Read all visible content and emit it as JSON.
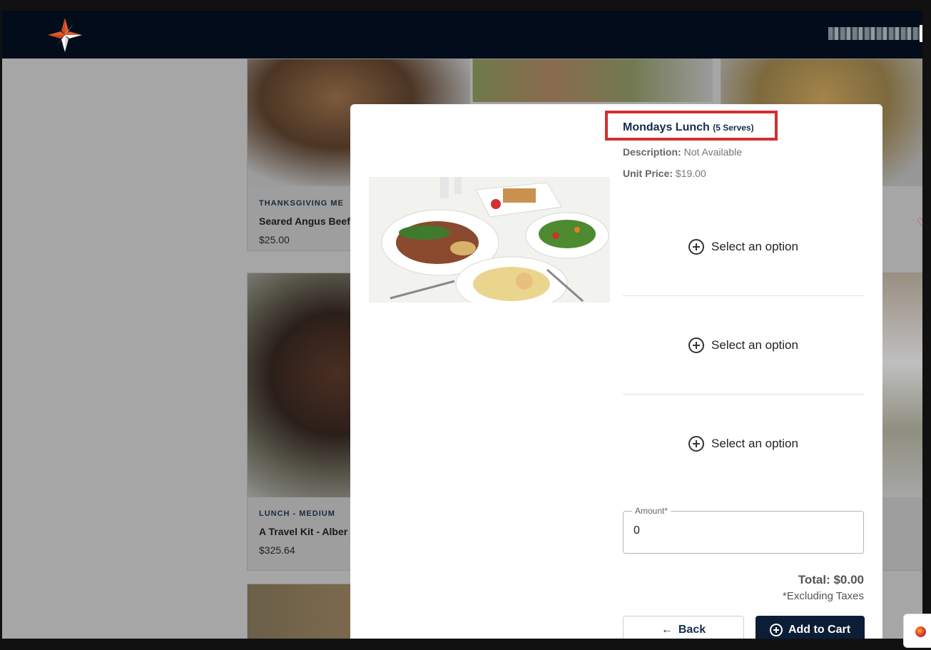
{
  "brand": {
    "logo_icon": "compass-star-icon",
    "accent": "#e05a2b",
    "navbar_bg": "#020c1b"
  },
  "background_cards": [
    {
      "category": "THANKSGIVING ME",
      "name": "Seared Angus Beef",
      "price": "$25.00"
    },
    {
      "category": "LUNCH - MEDIUM",
      "name": "A Travel Kit - Alber",
      "price": "$325.64"
    }
  ],
  "modal": {
    "title": "Mondays Lunch",
    "serves": "(5 Serves)",
    "description_label": "Description:",
    "description_value": "Not Available",
    "unit_price_label": "Unit Price:",
    "unit_price_value": "$19.00",
    "options": [
      {
        "label": "Select an option",
        "icon": "plus-circle-icon"
      },
      {
        "label": "Select an option",
        "icon": "plus-circle-icon"
      },
      {
        "label": "Select an option",
        "icon": "plus-circle-icon"
      }
    ],
    "amount": {
      "label": "Amount*",
      "value": "0"
    },
    "total": "Total: $0.00",
    "tax_note": "*Excluding Taxes",
    "back_label": "Back",
    "add_to_cart_label": "Add to Cart",
    "highlight_color": "#d32f2f",
    "primary_color": "#0c1e36"
  }
}
